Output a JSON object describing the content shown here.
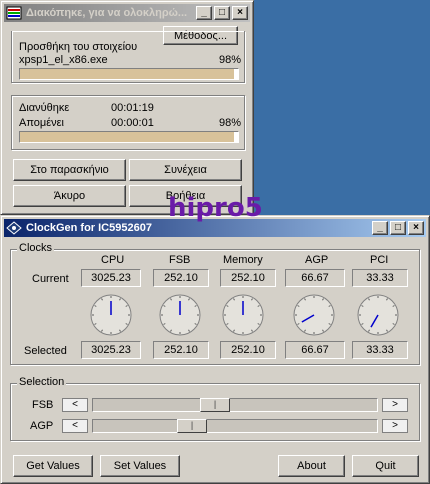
{
  "installer": {
    "title": "Διακόπηκε, για να ολοκληρώ...",
    "methods_button": "Μέθοδος...",
    "add_item_label": "Προσθήκη του στοιχείου",
    "file_name": "xpsp1_el_x86.exe",
    "file_percent": "98%",
    "file_progress": 0.98,
    "elapsed_label": "Διανύθηκε",
    "elapsed_value": "00:01:19",
    "remaining_label": "Απομένει",
    "remaining_value": "00:00:01",
    "total_percent": "98%",
    "total_progress": 0.98,
    "buttons": {
      "background": "Στο παρασκήνιο",
      "continue": "Συνέχεια",
      "cancel": "Άκυρο",
      "help": "Βοήθεια"
    }
  },
  "watermark": "hipro5",
  "clockgen": {
    "title": "ClockGen for IC5952607",
    "clocks_label": "Clocks",
    "columns": [
      "CPU",
      "FSB",
      "Memory",
      "AGP",
      "PCI"
    ],
    "current_label": "Current",
    "current_values": [
      "3025.23",
      "252.10",
      "252.10",
      "66.67",
      "33.33"
    ],
    "selected_label": "Selected",
    "selected_values": [
      "3025.23",
      "252.10",
      "252.10",
      "66.67",
      "33.33"
    ],
    "gauge_angles_deg": [
      0,
      0,
      0,
      240,
      210
    ],
    "selection_label": "Selection",
    "sliders": [
      {
        "label": "FSB",
        "level": 0.42
      },
      {
        "label": "AGP",
        "level": 0.33
      }
    ],
    "buttons": {
      "get_values": "Get Values",
      "set_values": "Set Values",
      "about": "About",
      "quit": "Quit"
    }
  },
  "colors": {
    "desktop": "#3a6ea5",
    "progress_fill": "#d8c29a",
    "needle": "#0000cc"
  }
}
